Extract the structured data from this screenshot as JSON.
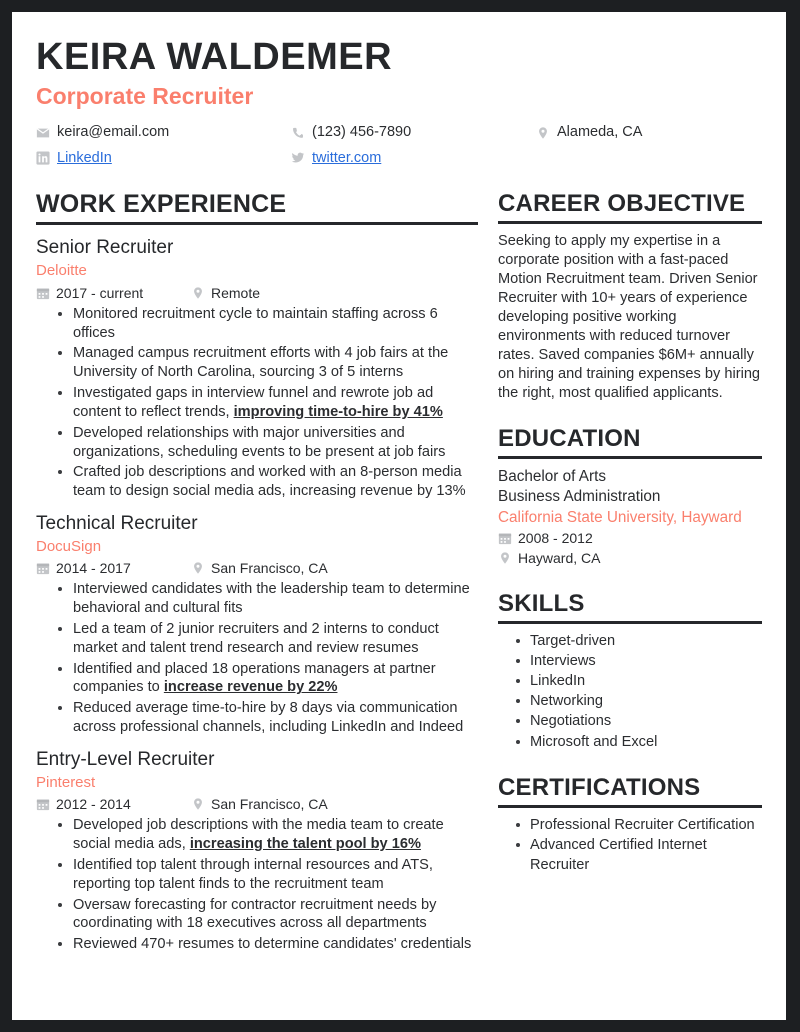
{
  "accent_color": "#fa7f6d",
  "text_color": "#2b2d30",
  "link_color": "#2a6ddb",
  "header": {
    "name": "KEIRA WALDEMER",
    "job_title": "Corporate Recruiter",
    "contacts": [
      {
        "icon": "envelope-icon",
        "text": "keira@email.com",
        "is_link": false
      },
      {
        "icon": "phone-icon",
        "text": "(123) 456-7890",
        "is_link": false
      },
      {
        "icon": "location-pin-icon",
        "text": "Alameda, CA",
        "is_link": false
      },
      {
        "icon": "linkedin-icon",
        "text": "LinkedIn",
        "is_link": true
      },
      {
        "icon": "twitter-icon",
        "text": "twitter.com",
        "is_link": true
      }
    ]
  },
  "work_experience": {
    "heading": "WORK EXPERIENCE",
    "entries": [
      {
        "title": "Senior Recruiter",
        "organization": "Deloitte",
        "dates": "2017 - current",
        "location": "Remote",
        "bullets": [
          {
            "pre": "Monitored recruitment cycle to maintain staffing across 6 offices",
            "highlight": "",
            "post": ""
          },
          {
            "pre": "Managed campus recruitment efforts with 4 job fairs at the University of North Carolina, sourcing 3 of 5 interns",
            "highlight": "",
            "post": ""
          },
          {
            "pre": "Investigated gaps in interview funnel and rewrote job ad content to reflect trends, ",
            "highlight": "improving time-to-hire by 41%",
            "post": ""
          },
          {
            "pre": "Developed relationships with major universities and organizations, scheduling events to be present at job fairs",
            "highlight": "",
            "post": ""
          },
          {
            "pre": "Crafted job descriptions and worked with an 8-person media team to design social media ads, increasing revenue by 13%",
            "highlight": "",
            "post": ""
          }
        ]
      },
      {
        "title": "Technical Recruiter",
        "organization": "DocuSign",
        "dates": "2014 - 2017",
        "location": "San Francisco, CA",
        "bullets": [
          {
            "pre": "Interviewed candidates with the leadership team to determine behavioral and cultural fits",
            "highlight": "",
            "post": ""
          },
          {
            "pre": "Led a team of 2 junior recruiters and 2 interns to conduct market and talent trend research and review resumes",
            "highlight": "",
            "post": ""
          },
          {
            "pre": "Identified and placed 18 operations managers at partner companies to ",
            "highlight": "increase revenue by 22%",
            "post": ""
          },
          {
            "pre": "Reduced average time-to-hire by 8 days via communication across professional channels, including LinkedIn and Indeed",
            "highlight": "",
            "post": ""
          }
        ]
      },
      {
        "title": "Entry-Level Recruiter",
        "organization": "Pinterest",
        "dates": "2012 - 2014",
        "location": "San Francisco, CA",
        "bullets": [
          {
            "pre": "Developed job descriptions with the media team to create social media ads, ",
            "highlight": "increasing the talent pool by 16%",
            "post": ""
          },
          {
            "pre": "Identified top talent through internal resources and ATS, reporting top talent finds to the recruitment team",
            "highlight": "",
            "post": ""
          },
          {
            "pre": "Oversaw forecasting for contractor recruitment needs by coordinating with 18 executives across all departments",
            "highlight": "",
            "post": ""
          },
          {
            "pre": "Reviewed 470+ resumes to determine candidates' credentials",
            "highlight": "",
            "post": ""
          }
        ]
      }
    ]
  },
  "career_objective": {
    "heading": "CAREER OBJECTIVE",
    "text": "Seeking to apply my expertise in a corporate position with a fast-paced Motion Recruitment team. Driven Senior Recruiter with 10+ years of experience developing positive working environments with reduced turnover rates. Saved companies $6M+ annually on hiring and training expenses by hiring the right, most qualified applicants."
  },
  "education": {
    "heading": "EDUCATION",
    "degree": "Bachelor of Arts",
    "field": "Business Administration",
    "school": "California State University, Hayward",
    "dates": "2008 - 2012",
    "location": "Hayward, CA"
  },
  "skills": {
    "heading": "SKILLS",
    "items": [
      "Target-driven",
      "Interviews",
      "LinkedIn",
      "Networking",
      "Negotiations",
      "Microsoft and Excel"
    ]
  },
  "certifications": {
    "heading": "CERTIFICATIONS",
    "items": [
      "Professional Recruiter Certification",
      "Advanced Certified Internet Recruiter"
    ]
  }
}
